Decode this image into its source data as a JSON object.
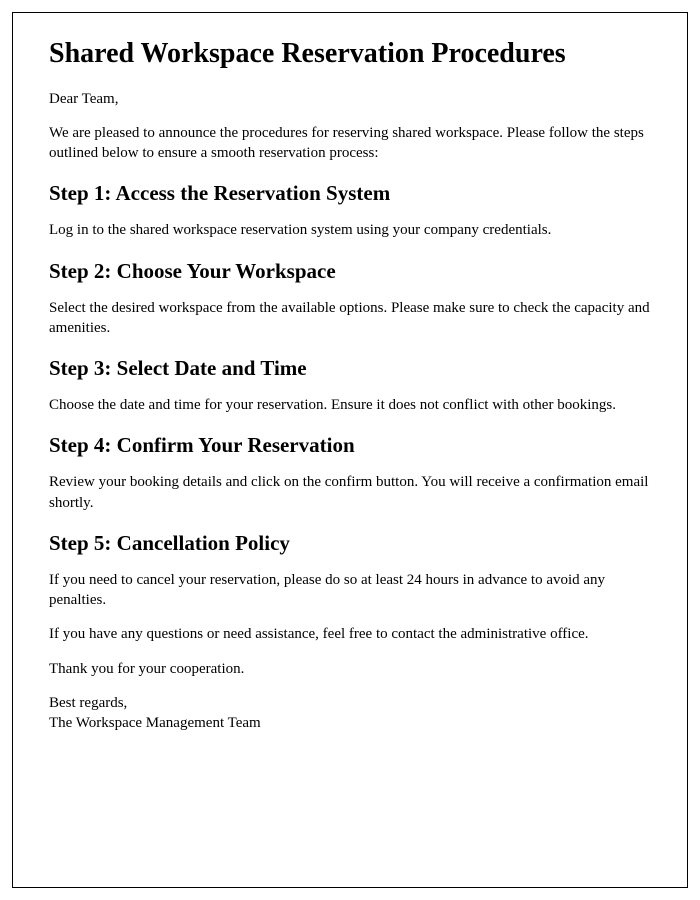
{
  "title": "Shared Workspace Reservation Procedures",
  "salutation": "Dear Team,",
  "intro": "We are pleased to announce the procedures for reserving shared workspace. Please follow the steps outlined below to ensure a smooth reservation process:",
  "steps": [
    {
      "heading": "Step 1: Access the Reservation System",
      "body": "Log in to the shared workspace reservation system using your company credentials."
    },
    {
      "heading": "Step 2: Choose Your Workspace",
      "body": "Select the desired workspace from the available options. Please make sure to check the capacity and amenities."
    },
    {
      "heading": "Step 3: Select Date and Time",
      "body": "Choose the date and time for your reservation. Ensure it does not conflict with other bookings."
    },
    {
      "heading": "Step 4: Confirm Your Reservation",
      "body": "Review your booking details and click on the confirm button. You will receive a confirmation email shortly."
    },
    {
      "heading": "Step 5: Cancellation Policy",
      "body": "If you need to cancel your reservation, please do so at least 24 hours in advance to avoid any penalties."
    }
  ],
  "closing_help": "If you have any questions or need assistance, feel free to contact the administrative office.",
  "closing_thanks": "Thank you for your cooperation.",
  "signoff_regards": "Best regards,",
  "signoff_team": "The Workspace Management Team"
}
